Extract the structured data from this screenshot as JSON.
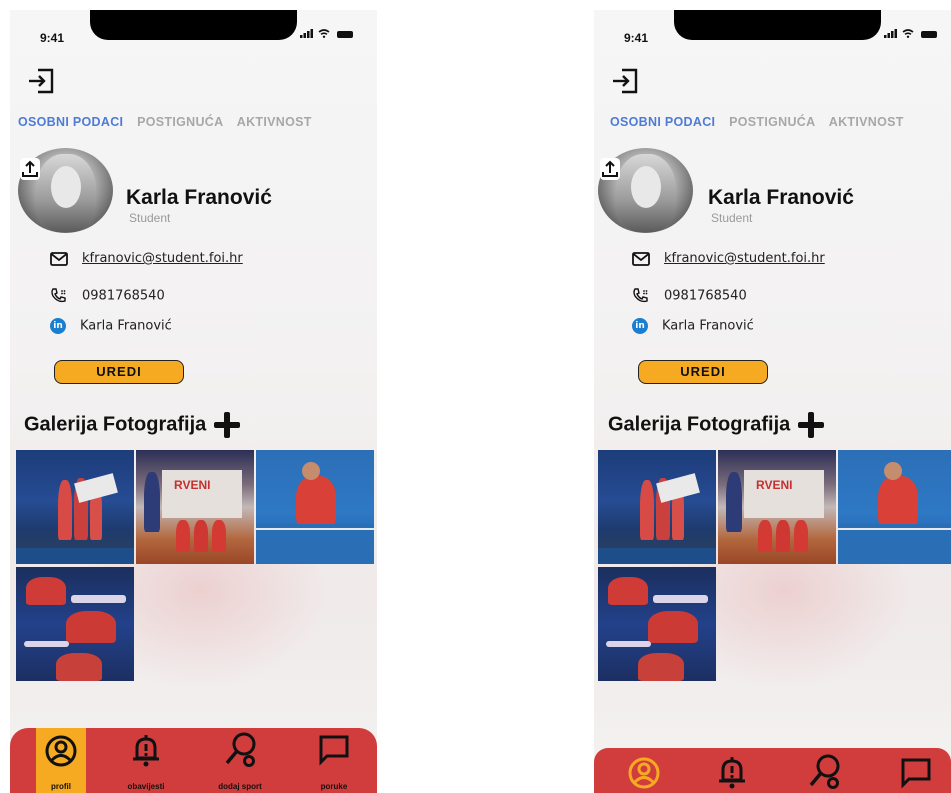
{
  "status": {
    "time": "9:41"
  },
  "tabs": {
    "personal": "OSOBNI PODACI",
    "achievements": "POSTIGNUĆA",
    "activity": "AKTIVNOST"
  },
  "profile": {
    "name": "Karla Franović",
    "role": "Student",
    "email": "kfranovic@student.foi.hr",
    "phone": "0981768540",
    "linkedin": "Karla Franović",
    "linkedin_badge": "in"
  },
  "actions": {
    "edit_label": "UREDI"
  },
  "gallery": {
    "title": "Galerija Fotografija"
  },
  "nav": {
    "profile": "profil",
    "notifications": "obavijesti",
    "add_sport": "dodaj sport",
    "messages": "poruke"
  },
  "colors": {
    "accent_blue": "#4d7bd6",
    "button_orange": "#f6aa22",
    "nav_red": "#d13d3d",
    "linkedin_blue": "#1a7fd0"
  }
}
